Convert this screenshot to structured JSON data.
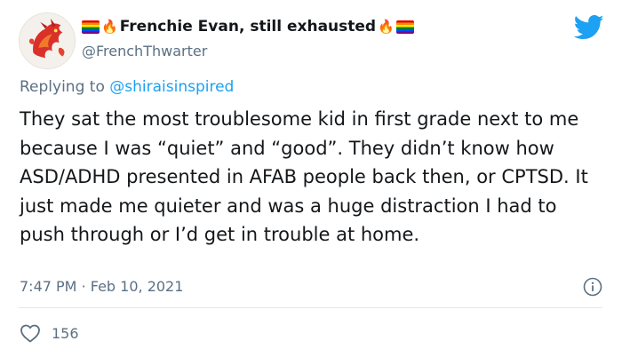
{
  "author": {
    "display_name": "Frenchie Evan, still exhausted",
    "handle": "@FrenchThwarter",
    "avatar_icon": "dragon-avatar-icon",
    "name_decorations": [
      "rainbow-flag-icon",
      "fire-icon"
    ]
  },
  "reply": {
    "prefix": "Replying to ",
    "mention": "@shiraisinspired"
  },
  "tweet": {
    "text": "They sat the most troublesome kid in first grade next to me because I was “quiet” and “good”. They didn’t know how ASD/ADHD presented in AFAB people back then, or CPTSD. It just made me quieter and was a huge distraction I had to push through or I’d get in trouble at home.",
    "time": "7:47 PM",
    "separator": "·",
    "date": "Feb 10, 2021"
  },
  "stats": {
    "likes": "156"
  },
  "icons": {
    "brand": "twitter-bird-icon",
    "info": "info-icon",
    "like": "heart-icon"
  },
  "colors": {
    "brand_blue": "#1da1f2",
    "secondary_text": "#5b7083",
    "primary_text": "#14171a",
    "divider": "#e1e8ed"
  }
}
